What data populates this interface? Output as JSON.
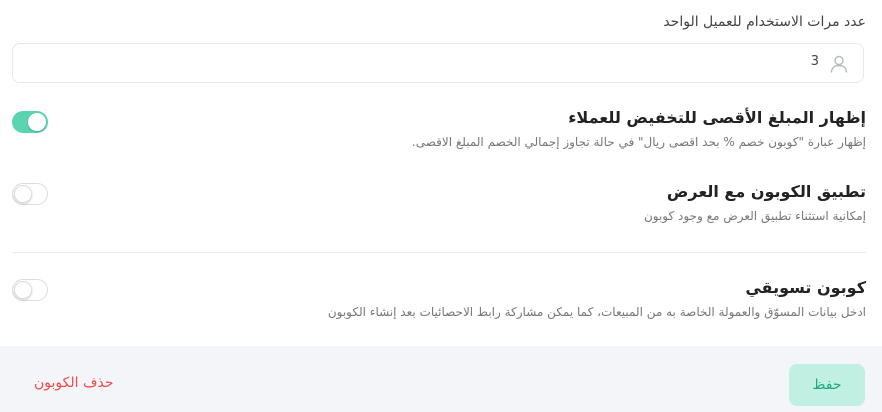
{
  "usage_field": {
    "label": "عدد مرات الاستخدام للعميل الواحد",
    "value": "3",
    "icon": "user-icon"
  },
  "settings": [
    {
      "title": "إظهار المبلغ الأقصى للتخفيض للعملاء",
      "description": "إظهار عبارة \"كوبون خصم % بحد اقصى ريال\" في حالة تجاوز إجمالي الخصم المبلغ الاقصى.",
      "enabled": true
    },
    {
      "title": "تطبيق الكوبون مع العرض",
      "description": "إمكانية استثناء تطبيق العرض مع وجود كوبون",
      "enabled": false
    },
    {
      "title": "كوبون تسويقي",
      "description": "ادخل بيانات المسوّق والعمولة الخاصة به من المبيعات، كما يمكن مشاركة رابط الاحصائيات بعد إنشاء الكوبون",
      "enabled": false
    }
  ],
  "footer": {
    "save_label": "حفظ",
    "delete_label": "حذف الكوبون"
  },
  "colors": {
    "toggle_on": "#5bd4b3",
    "save_bg": "#bff0e1",
    "save_text": "#23a680",
    "delete_text": "#ee4b4b",
    "footer_bg": "#f3f5f8"
  }
}
